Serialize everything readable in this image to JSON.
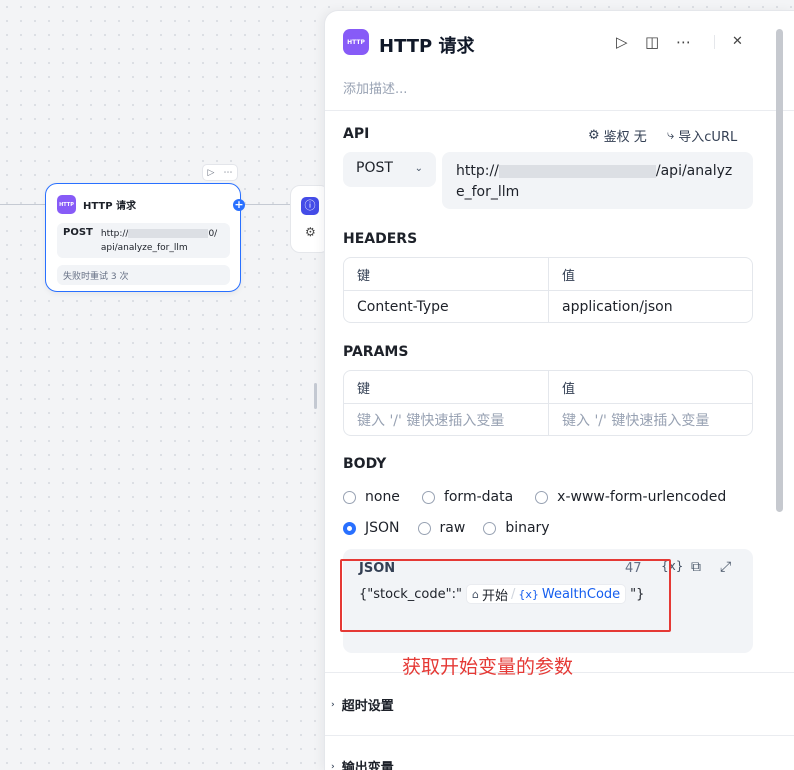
{
  "canvas": {
    "node": {
      "logo_text": "HTTP",
      "title": "HTTP 请求",
      "method": "POST",
      "url_prefix": "http://",
      "url_suffix": "0/api/analyze_for_llm",
      "retry_text": "失败时重试 3 次",
      "toolbar_run": "▷",
      "toolbar_more": "⋯",
      "add_icon": "+"
    },
    "next_node": {
      "icon1": "ⓘ",
      "icon2": "⚙"
    }
  },
  "panel": {
    "logo_text": "HTTP",
    "title": "HTTP 请求",
    "header_icons": {
      "run": "▷",
      "docs": "◫",
      "more": "⋯",
      "close": "✕"
    },
    "description_placeholder": "添加描述...",
    "api": {
      "label": "API",
      "auth_icon": "⚙",
      "auth_label": "鉴权 无",
      "import_icon": "⤷",
      "import_label": "导入cURL",
      "method": "POST",
      "method_chevron": "⌄",
      "url_prefix": "http://",
      "url_suffix": "/api/analyze_for_llm"
    },
    "headers": {
      "label": "HEADERS",
      "col_key": "键",
      "col_value": "值",
      "rows": [
        {
          "key": "Content-Type",
          "value": "application/json"
        }
      ]
    },
    "params": {
      "label": "PARAMS",
      "col_key": "键",
      "col_value": "值",
      "key_placeholder": "键入 '/' 键快速插入变量",
      "value_placeholder": "键入 '/' 键快速插入变量"
    },
    "body": {
      "label": "BODY",
      "options_row1": [
        "none",
        "form-data",
        "x-www-form-urlencoded"
      ],
      "options_row2": [
        "JSON",
        "raw",
        "binary"
      ],
      "selected": "JSON",
      "editor": {
        "label": "JSON",
        "char_count": "47",
        "var_icon": "{x}",
        "copy_icon": "⧉",
        "expand_icon": "⤢",
        "prefix": "{\"stock_code\":\"",
        "var_home_icon": "⌂",
        "var_node": "开始",
        "var_sep": "/",
        "var_x_icon": "{x}",
        "var_name": "WealthCode",
        "suffix": "\"}"
      }
    },
    "timeout_label": "超时设置",
    "output_label": "输出变量",
    "collapse_arrow": "›"
  },
  "annotation": {
    "text": "获取开始变量的参数",
    "color": "#e53935"
  },
  "colors": {
    "accent": "#2970ff",
    "logo": "#875bf7",
    "annotation": "#e53935"
  }
}
